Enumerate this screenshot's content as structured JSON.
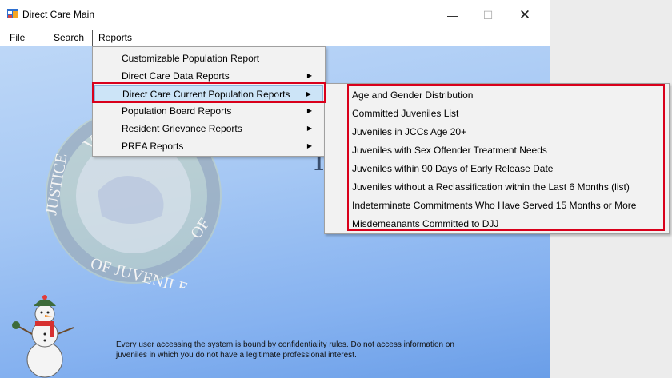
{
  "window": {
    "title": "Direct Care Main"
  },
  "controls": {
    "minimize": "—",
    "maximize": "☐",
    "close": "✕"
  },
  "menubar": {
    "file": "File",
    "search": "Search",
    "reports": "Reports"
  },
  "reports_menu": {
    "items": [
      {
        "label": "Customizable Population Report",
        "submenu": false
      },
      {
        "label": "Direct Care Data Reports",
        "submenu": true
      },
      {
        "label": "Direct Care Current Population Reports",
        "submenu": true,
        "highlighted": true
      },
      {
        "label": "Population Board Reports",
        "submenu": true
      },
      {
        "label": "Resident Grievance Reports",
        "submenu": true
      },
      {
        "label": "PREA Reports",
        "submenu": true
      }
    ]
  },
  "current_population_submenu": {
    "items": [
      "Age and Gender Distribution",
      "Committed Juveniles List",
      "Juveniles in JCCs Age 20+",
      "Juveniles with Sex Offender Treatment Needs",
      "Juveniles within 90 Days of Early Release Date",
      "Juveniles without a Reclassification within the Last 6 Months (list)",
      "Indeterminate Commitments Who Have Served 15 Months or More",
      "Misdemeanants Committed to DJJ"
    ]
  },
  "seal": {
    "text_top": "VIRGINIA",
    "text_left": "JUSTICE",
    "text_bottom": "OF JUVENILE",
    "text_right": "OF"
  },
  "background_letter": "I",
  "notice": {
    "text": "Every user accessing the system is bound by confidentiality rules. Do not access information on juveniles in which you do not have a legitimate professional interest."
  },
  "colors": {
    "highlight": "#cce4f7",
    "annotation_red": "#d9001b",
    "content_blue": "#86b2f0"
  }
}
